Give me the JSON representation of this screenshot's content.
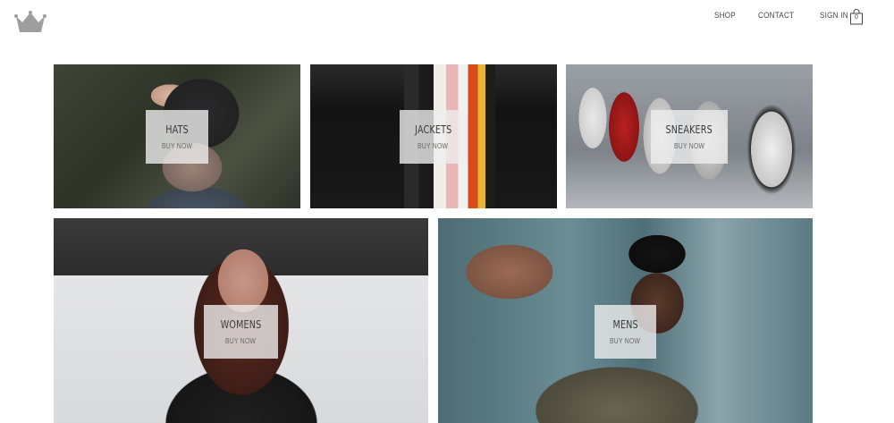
{
  "header": {
    "logo_icon": "crown-icon",
    "nav": [
      {
        "label": "SHOP"
      },
      {
        "label": "CONTACT"
      },
      {
        "label": "SIGN IN"
      }
    ],
    "cart": {
      "icon": "shopping-bag-icon",
      "count": "0"
    }
  },
  "categories": [
    {
      "title": "HATS",
      "cta": "BUY NOW"
    },
    {
      "title": "JACKETS",
      "cta": "BUY NOW"
    },
    {
      "title": "SNEAKERS",
      "cta": "BUY NOW"
    },
    {
      "title": "WOMENS",
      "cta": "BUY NOW"
    },
    {
      "title": "MENS",
      "cta": "BUY NOW"
    }
  ],
  "colors": {
    "background": "#ffffff",
    "nav_text": "#444444",
    "label_box": "#eeeeee",
    "label_title": "#3a3a3a"
  }
}
